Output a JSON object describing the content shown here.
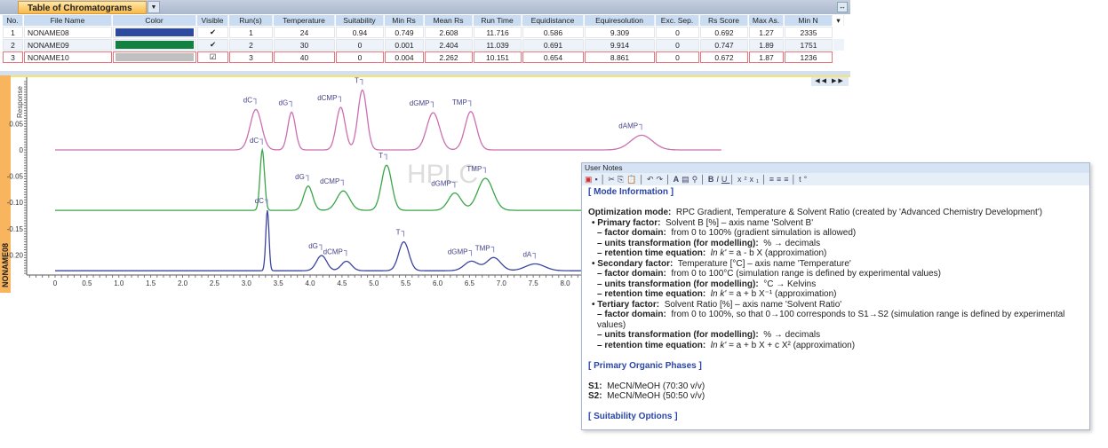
{
  "panel": {
    "tab_title": "Table of Chromatograms"
  },
  "table": {
    "columns": [
      "No.",
      "File Name",
      "Color",
      "Visible",
      "Run(s)",
      "Temperature",
      "Suitability",
      "Min Rs",
      "Mean Rs",
      "Run Time",
      "Equidistance",
      "Equiresolution",
      "Exc. Sep.",
      "Rs Score",
      "Max As.",
      "Min N"
    ],
    "rows": [
      {
        "no": "1",
        "file": "NONAME08",
        "color": "#2e4a9e",
        "visible": "✔",
        "runs": "1",
        "temperature": "24",
        "suitability": "0.94",
        "min_rs": "0.749",
        "mean_rs": "2.608",
        "run_time": "11.716",
        "equidistance": "0.586",
        "equiresolution": "9.309",
        "exc_sep": "0",
        "rs_score": "0.692",
        "max_as": "1.27",
        "min_n": "2335"
      },
      {
        "no": "2",
        "file": "NONAME09",
        "color": "#128040",
        "visible": "✔",
        "runs": "2",
        "temperature": "30",
        "suitability": "0",
        "min_rs": "0.001",
        "mean_rs": "2.404",
        "run_time": "11.039",
        "equidistance": "0.691",
        "equiresolution": "9.914",
        "exc_sep": "0",
        "rs_score": "0.747",
        "max_as": "1.89",
        "min_n": "1751"
      },
      {
        "no": "3",
        "file": "NONAME10",
        "color": "#c0c0c0",
        "visible": "☑",
        "runs": "3",
        "temperature": "40",
        "suitability": "0",
        "min_rs": "0.004",
        "mean_rs": "2.262",
        "run_time": "10.151",
        "equidistance": "0.654",
        "equiresolution": "8.861",
        "exc_sep": "0",
        "rs_score": "0.672",
        "max_as": "1.87",
        "min_n": "1236"
      }
    ]
  },
  "chart_panel": {
    "side_label": "NONAME08",
    "watermark": "HPLC"
  },
  "chart_data": {
    "type": "line",
    "ylabel": "Response",
    "xlim": [
      0,
      8.2
    ],
    "ylim": [
      -0.235,
      0.135
    ],
    "xticks": [
      "0",
      "0.5",
      "1.0",
      "1.5",
      "2.0",
      "2.5",
      "3.0",
      "3.5",
      "4.0",
      "4.5",
      "5.0",
      "5.5",
      "6.0",
      "6.5",
      "7.0",
      "7.5",
      "8.0"
    ],
    "yticks": [
      "0.05",
      "0",
      "-0.05",
      "-0.10",
      "-0.15",
      "-0.20"
    ],
    "grid": false,
    "series": [
      {
        "color": "#cc6fb0",
        "baseline": 0,
        "x_range": [
          0,
          10.45
        ],
        "peaks": [
          {
            "label": "dC",
            "rt": 3.15,
            "y": 0.077,
            "sigma": 0.09
          },
          {
            "label": "dG",
            "rt": 3.71,
            "y": 0.072,
            "sigma": 0.06
          },
          {
            "label": "dCMP",
            "rt": 4.48,
            "y": 0.081,
            "sigma": 0.07
          },
          {
            "label": "T",
            "rt": 4.82,
            "y": 0.114,
            "sigma": 0.07
          },
          {
            "label": "dGMP",
            "rt": 5.93,
            "y": 0.071,
            "sigma": 0.1
          },
          {
            "label": "TMP",
            "rt": 6.52,
            "y": 0.073,
            "sigma": 0.09
          },
          {
            "label": "dAMP",
            "rt": 9.2,
            "y": 0.028,
            "sigma": 0.17
          }
        ]
      },
      {
        "color": "#3aa648",
        "baseline": -0.115,
        "x_range": [
          0,
          10.2
        ],
        "peaks": [
          {
            "label": "dC",
            "rt": 3.25,
            "y": 0.0,
            "sigma": 0.035
          },
          {
            "label": "dG",
            "rt": 3.97,
            "y": -0.069,
            "sigma": 0.07
          },
          {
            "label": "dCMP",
            "rt": 4.52,
            "y": -0.078,
            "sigma": 0.1
          },
          {
            "label": "T",
            "rt": 5.2,
            "y": -0.029,
            "sigma": 0.08
          },
          {
            "label": "dGMP",
            "rt": 6.27,
            "y": -0.082,
            "sigma": 0.1
          },
          {
            "label": "TMP",
            "rt": 6.75,
            "y": -0.054,
            "sigma": 0.12
          }
        ]
      },
      {
        "color": "#3b45a0",
        "baseline": -0.23,
        "x_range": [
          0,
          8.3
        ],
        "peaks": [
          {
            "label": "dC",
            "rt": 3.33,
            "y": -0.115,
            "sigma": 0.025
          },
          {
            "label": "dG",
            "rt": 4.18,
            "y": -0.201,
            "sigma": 0.08
          },
          {
            "label": "dCMP",
            "rt": 4.57,
            "y": -0.212,
            "sigma": 0.08
          },
          {
            "label": "T",
            "rt": 5.47,
            "y": -0.175,
            "sigma": 0.08
          },
          {
            "label": "dGMP",
            "rt": 6.53,
            "y": -0.212,
            "sigma": 0.11
          },
          {
            "label": "TMP",
            "rt": 6.88,
            "y": -0.205,
            "sigma": 0.11
          },
          {
            "label": "dA",
            "rt": 7.53,
            "y": -0.217,
            "sigma": 0.15
          }
        ]
      }
    ]
  },
  "notes": {
    "title": "User Notes",
    "mode_header": "[  Mode Information  ]",
    "opt_label": "Optimization mode:",
    "opt_value": "RPC Gradient, Temperature & Solvent Ratio (created by 'Advanced Chemistry Development')",
    "factors": [
      {
        "label": "• Primary factor:",
        "value": "Solvent B [%] – axis name 'Solvent B'",
        "domain": "from 0 to 100% (gradient simulation is allowed)",
        "units": "% → decimals",
        "eq_pre": "ln k'",
        "eq": "= a - b X (approximation)"
      },
      {
        "label": "• Secondary factor:",
        "value": "Temperature [°C] – axis name 'Temperature'",
        "domain": "from 0 to 100°C (simulation range is defined by experimental values)",
        "units": "°C → Kelvins",
        "eq_pre": "ln k'",
        "eq": "= a + b X⁻¹ (approximation)"
      },
      {
        "label": "• Tertiary factor:",
        "value": "Solvent Ratio [%] – axis name 'Solvent Ratio'",
        "domain": "from 0 to 100%, so that 0→100 corresponds to S1→S2 (simulation range is defined by experimental values)",
        "units": "% → decimals",
        "eq_pre": "ln k'",
        "eq": "= a + b X + c X² (approximation)"
      }
    ],
    "domain_label": "– factor domain:",
    "units_label": "– units transformation (for modelling):",
    "eq_label": "– retention time equation:",
    "phases_header": "[  Primary Organic Phases  ]",
    "s1_label": "S1:",
    "s1": "MeCN/MeOH (70:30 v/v)",
    "s2_label": "S2:",
    "s2": "MeCN/MeOH (50:50 v/v)",
    "suit_header": "[  Suitability Options  ]"
  }
}
